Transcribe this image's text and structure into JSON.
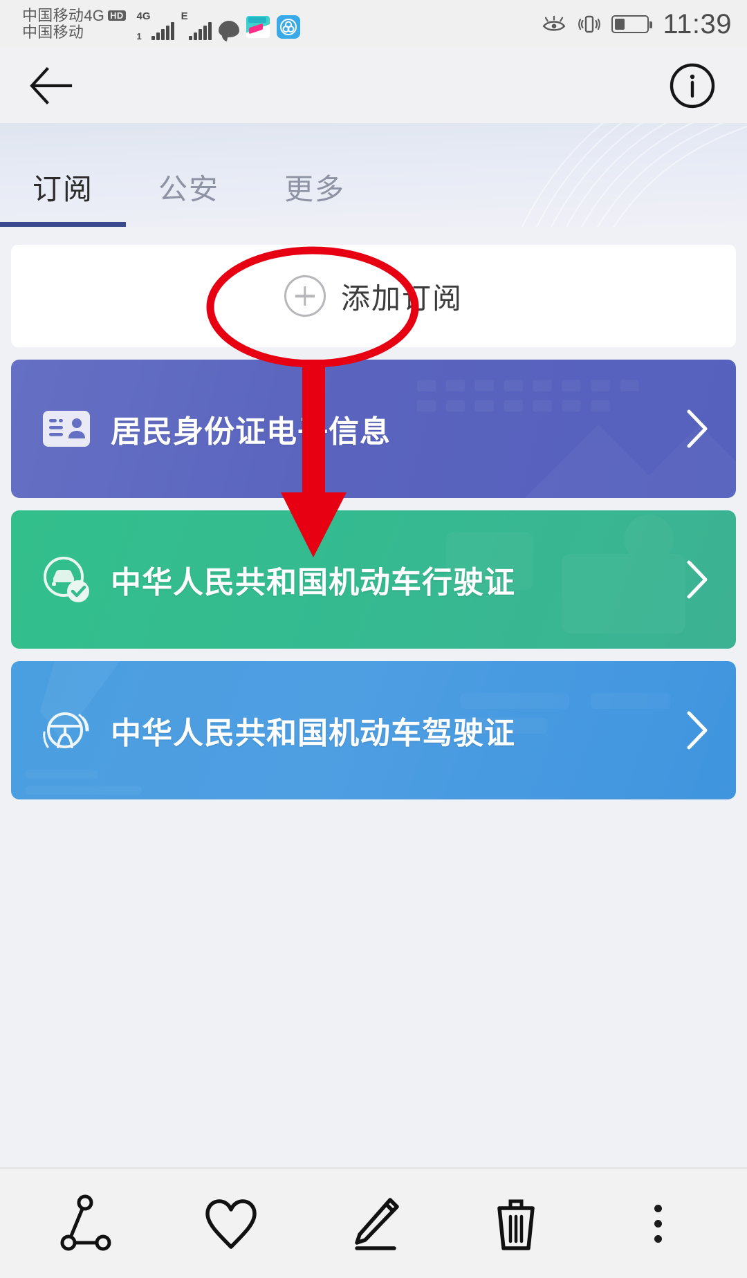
{
  "status_bar": {
    "carrier_line1": "中国移动4G",
    "hd_badge": "HD",
    "carrier_line2": "中国移动",
    "sim1_network": "4G",
    "sim1_index": "1",
    "sim2_network": "E",
    "time": "11:39",
    "icons": [
      "signal-4g-icon",
      "signal-e-icon",
      "chat-bubble-icon",
      "app-icon",
      "app-icon",
      "eye-comfort-icon",
      "vibrate-icon",
      "battery-icon"
    ],
    "battery_level_percent": 32
  },
  "nav_bar": {
    "back_icon": "arrow-left-icon",
    "info_icon": "info-circle-icon"
  },
  "tabs": [
    {
      "label": "订阅",
      "active": true
    },
    {
      "label": "公安",
      "active": false
    },
    {
      "label": "更多",
      "active": false
    }
  ],
  "add_subscription": {
    "label": "添加订阅",
    "icon": "plus-circle-icon"
  },
  "cards": [
    {
      "title": "居民身份证电子信息",
      "icon": "id-card-icon",
      "theme": "card-idcard",
      "accent": "#5a64be",
      "chevron": "chevron-right-icon"
    },
    {
      "title": "中华人民共和国机动车行驶证",
      "icon": "car-check-icon",
      "theme": "card-vehicle",
      "accent": "#34bb90",
      "chevron": "chevron-right-icon"
    },
    {
      "title": "中华人民共和国机动车驾驶证",
      "icon": "steering-wheel-icon",
      "theme": "card-driver",
      "accent": "#4e9ee2",
      "chevron": "chevron-right-icon"
    }
  ],
  "annotations": {
    "highlight_color": "#e60012",
    "ellipse_target": "添加订阅",
    "arrow_target": "中华人民共和国机动车行驶证"
  },
  "toolbar": [
    {
      "label": "分享",
      "icon": "share-nodes-icon"
    },
    {
      "label": "收藏",
      "icon": "heart-icon"
    },
    {
      "label": "编辑",
      "icon": "pencil-edit-icon"
    },
    {
      "label": "删除",
      "icon": "trash-icon"
    },
    {
      "label": "更多",
      "icon": "more-vertical-icon"
    }
  ]
}
